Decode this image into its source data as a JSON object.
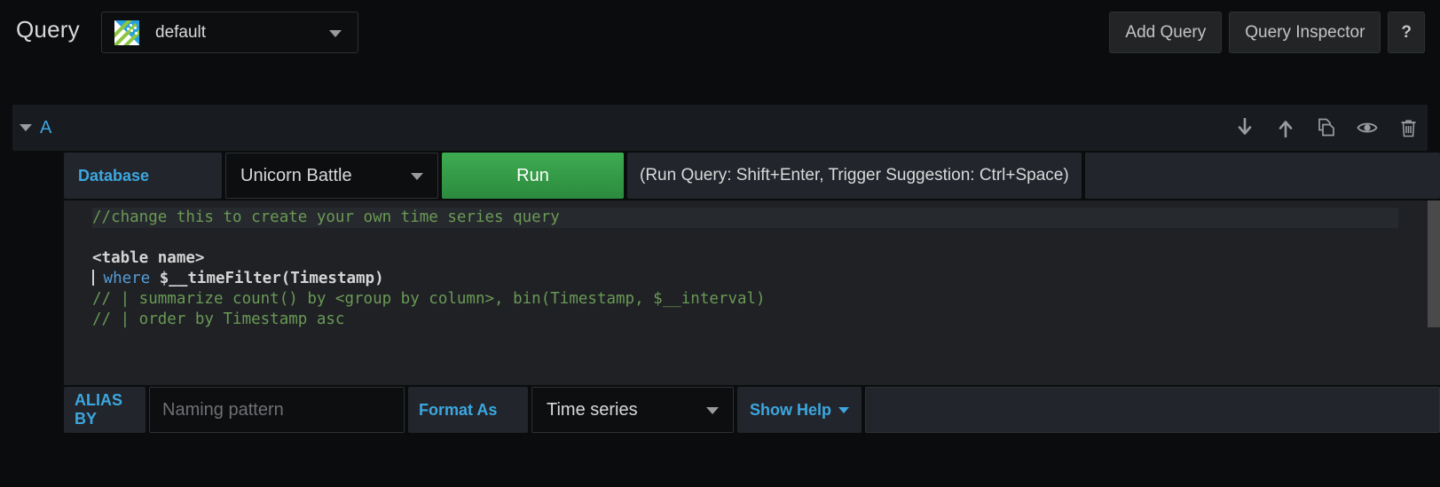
{
  "topbar": {
    "title": "Query",
    "datasource": {
      "name": "default",
      "icon": "azure-data-explorer-icon"
    },
    "buttons": [
      {
        "label": "Add Query",
        "name": "add-query-button"
      },
      {
        "label": "Query Inspector",
        "name": "query-inspector-button"
      },
      {
        "label": "?",
        "name": "help-button"
      }
    ]
  },
  "query": {
    "ref_id": "A",
    "actions": [
      {
        "name": "move-query-down-icon",
        "title": "arrow-down-icon"
      },
      {
        "name": "move-query-up-icon",
        "title": "arrow-up-icon"
      },
      {
        "name": "duplicate-query-icon",
        "title": "copy-icon"
      },
      {
        "name": "toggle-query-visibility-icon",
        "title": "eye-icon"
      },
      {
        "name": "remove-query-icon",
        "title": "trash-icon"
      }
    ],
    "database": {
      "label": "Database",
      "value": "Unicorn Battle"
    },
    "run": {
      "label": "Run",
      "hint": "(Run Query: Shift+Enter, Trigger Suggestion: Ctrl+Space)"
    },
    "editor": {
      "lines": [
        {
          "text": "//change this to create your own time series query",
          "cls": "cm",
          "highlight": true
        },
        {
          "text": "",
          "cls": "tk"
        },
        {
          "text": "<table name>",
          "cls": "pl"
        },
        {
          "text": "| where $__timeFilter(Timestamp)",
          "cls": "mix"
        },
        {
          "text": "// | summarize count() by <group by column>, bin(Timestamp, $__interval)",
          "cls": "cm"
        },
        {
          "text": "// | order by Timestamp asc",
          "cls": "cm"
        }
      ]
    },
    "alias": {
      "label": "ALIAS BY",
      "placeholder": "Naming pattern",
      "value": ""
    },
    "format": {
      "label": "Format As",
      "value": "Time series"
    },
    "show_help": {
      "label": "Show Help"
    }
  },
  "colors": {
    "accent_blue": "#3ca7e0",
    "run_green": "#2b8a3e",
    "comment_green": "#6a9955",
    "keyword_blue": "#569cd6",
    "panel_bg": "#181b1f",
    "editor_bg": "#1f2125"
  }
}
